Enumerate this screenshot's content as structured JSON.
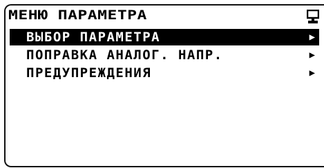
{
  "header": {
    "title": "МЕНЮ ПАРАМЕТРА",
    "icon": "monitor-icon"
  },
  "menu": {
    "items": [
      {
        "label": "ВЫБОР ПАРАМЕТРА",
        "arrow": "▶",
        "selected": true
      },
      {
        "label": "ПОПРАВКА АНАЛОГ. НАПР.",
        "arrow": "▶",
        "selected": false
      },
      {
        "label": "ПРЕДУПРЕЖДЕНИЯ",
        "arrow": "▶",
        "selected": false
      }
    ]
  }
}
